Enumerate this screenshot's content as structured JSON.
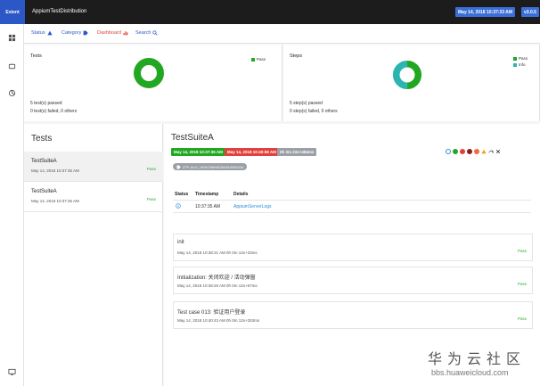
{
  "header": {
    "brand": "Extent",
    "app_title": "AppiumTestDistribution",
    "date": "May 14, 2018 10:37:33 AM",
    "version": "v3.0.5"
  },
  "rail": {
    "icons": [
      "dashboard-icon",
      "tests-icon",
      "categories-icon",
      "monitor-icon"
    ]
  },
  "nav": {
    "items": [
      {
        "label": "Status",
        "icon": "warning-icon",
        "color": "#2c57c7"
      },
      {
        "label": "Category",
        "icon": "tag-icon",
        "color": "#2c57c7"
      },
      {
        "label": "Dashboard",
        "icon": "bar-chart-icon",
        "color": "#e0413c"
      },
      {
        "label": "Search",
        "icon": "search-icon",
        "color": "#2c57c7"
      }
    ]
  },
  "summary": {
    "tests": {
      "title": "Tests",
      "legend": [
        {
          "label": "Pass",
          "color": "#22a722"
        }
      ],
      "line1": "5 test(s) passed",
      "line2": "0 test(s) failed, 0 others",
      "donut": [
        {
          "label": "Pass",
          "value": 5,
          "color": "#22a722"
        }
      ]
    },
    "steps": {
      "title": "Steps",
      "legend": [
        {
          "label": "Pass",
          "color": "#22a722"
        },
        {
          "label": "Info",
          "color": "#2ab5b1"
        }
      ],
      "line1": "5 step(s) passed",
      "line2": "0 step(s) failed, 0 others",
      "donut": [
        {
          "label": "Pass",
          "value": 5,
          "color": "#22a722"
        },
        {
          "label": "Info",
          "value": 5,
          "color": "#2ab5b1"
        }
      ]
    }
  },
  "tests_list": {
    "title": "Tests",
    "items": [
      {
        "name": "TestSuiteA",
        "time": "May 14, 2018 10:37:35 AM",
        "status": "Pass",
        "active": true
      },
      {
        "name": "TestSuiteA",
        "time": "May 14, 2018 10:37:35 AM",
        "status": "Pass",
        "active": false
      }
    ]
  },
  "detail": {
    "title": "TestSuiteA",
    "start_chip": "May 14, 2018 10:37:35 AM",
    "end_chip": "May 14, 2018 10:40:58 AM",
    "duration_chip": "0h 3m 23s+484ms",
    "tag": "ZTF-AUX_HDKO96KB03A031B0032A",
    "colors": {
      "start": "#22a722",
      "end": "#e0413c",
      "duration": "#9aa0a6"
    },
    "filters": [
      "info-icon",
      "pass-icon",
      "fail-icon",
      "fatal-icon",
      "error-icon",
      "warning-icon",
      "skip-icon",
      "clear-icon"
    ],
    "log": {
      "headers": {
        "status": "Status",
        "timestamp": "Timestamp",
        "details": "Details"
      },
      "rows": [
        {
          "status_icon": "info-icon",
          "timestamp": "10:37:35 AM",
          "details": "AppiumServerLogs"
        }
      ]
    },
    "nodes": [
      {
        "name": "init",
        "time": "May 14, 2018 10:38:21 AM 0h 0m 12s+33ms",
        "status": "Pass"
      },
      {
        "name": "Initialization: 关闭欢迎 / 活动弹窗",
        "time": "May 14, 2018 10:39:26 AM 0h 0m 12s+57ms",
        "status": "Pass"
      },
      {
        "name": "Test case 013: 验证用户登录",
        "time": "May 14, 2018 10:40:43 AM 0h 0m 12s+253ms",
        "status": "Pass"
      }
    ]
  },
  "watermark": {
    "name": "华为云社区",
    "url": "bbs.huaweicloud.com"
  }
}
